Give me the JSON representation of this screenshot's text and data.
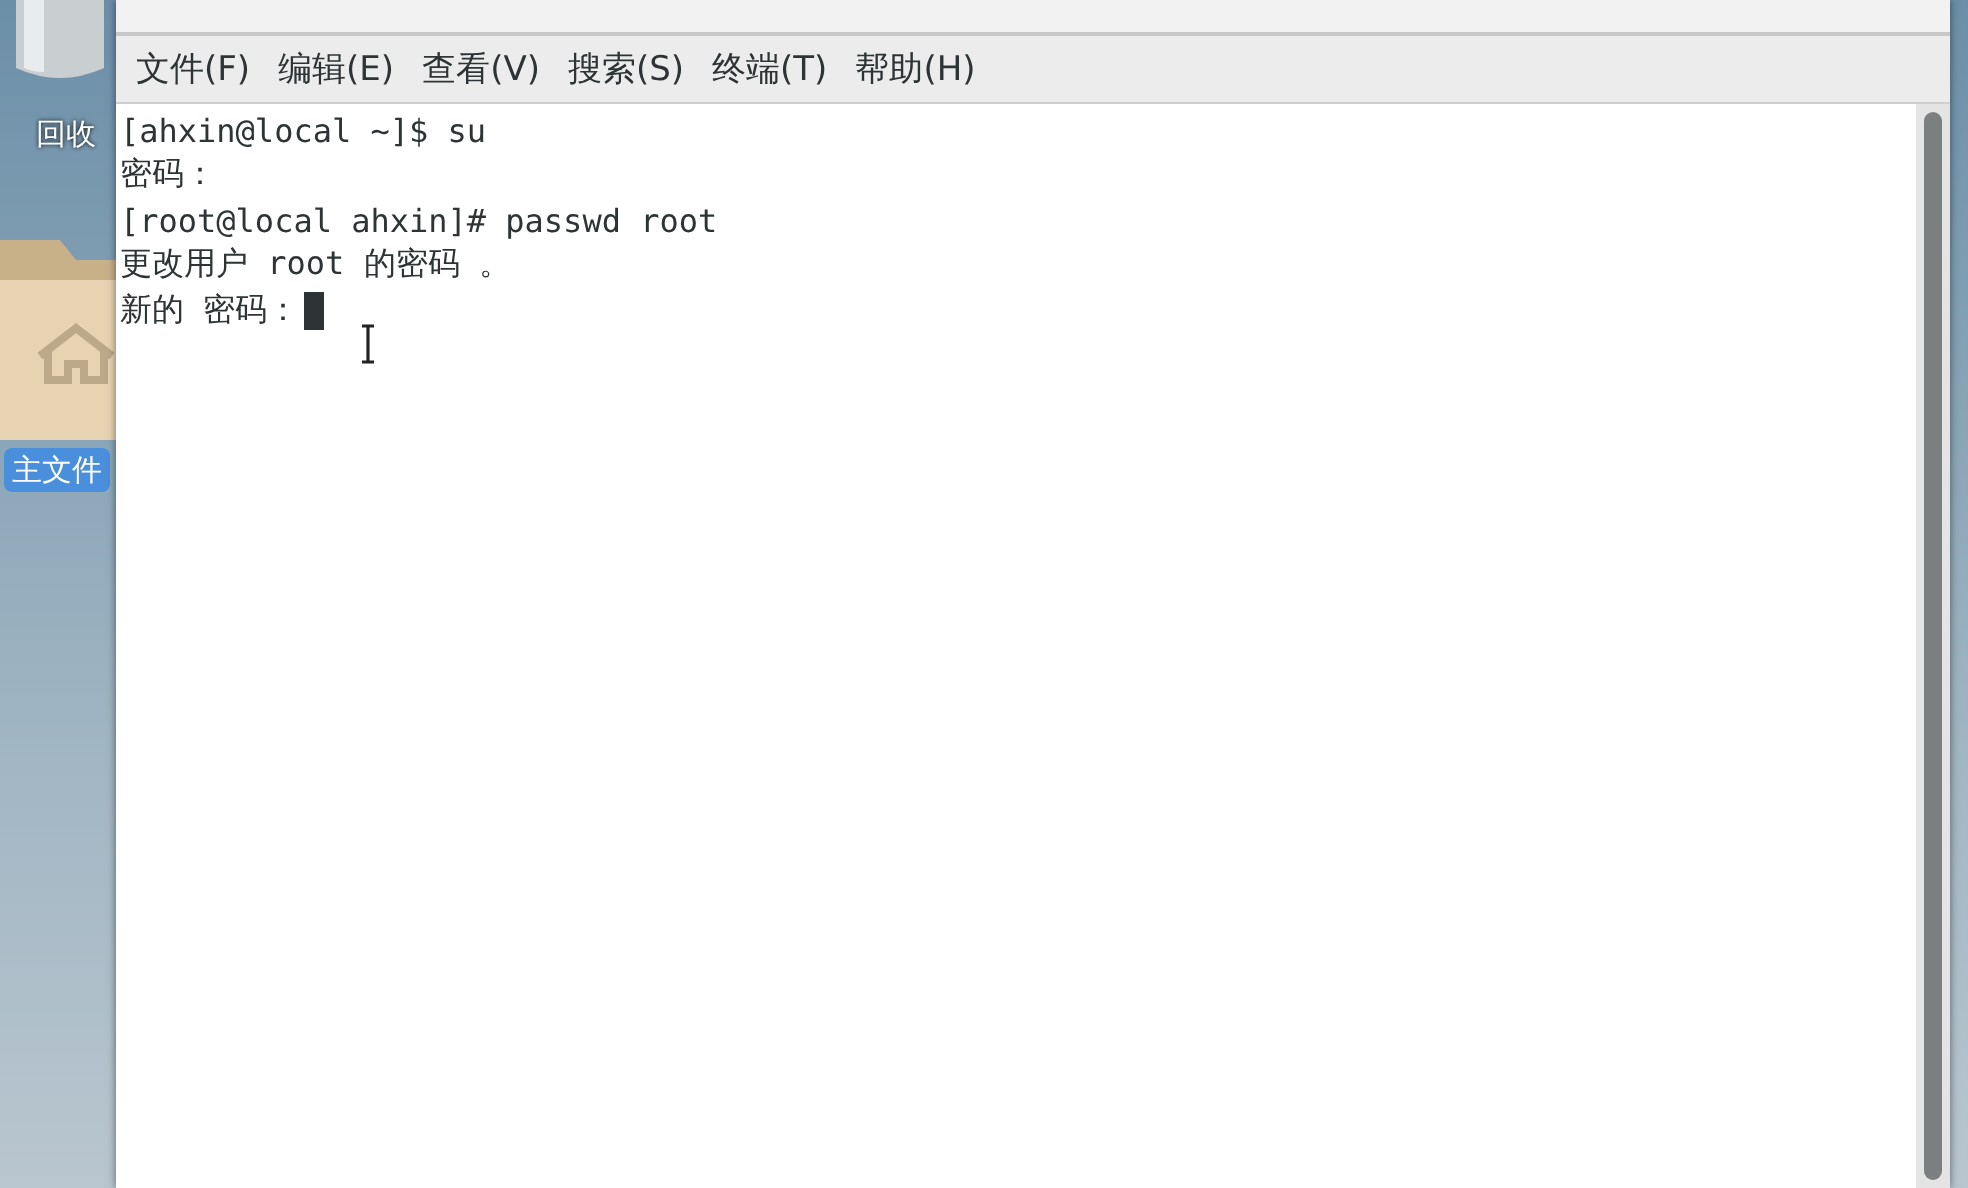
{
  "desktop": {
    "icons": [
      {
        "kind": "trash",
        "label": "回收",
        "selected": false
      },
      {
        "kind": "home-folder",
        "label": "主文件",
        "selected": true
      }
    ]
  },
  "menu_bar": {
    "items": [
      "文件(F)",
      "编辑(E)",
      "查看(V)",
      "搜索(S)",
      "终端(T)",
      "帮助(H)"
    ]
  },
  "terminal": {
    "lines": [
      "[ahxin@local ~]$ su",
      "密码：",
      "[root@local ahxin]# passwd root",
      "更改用户 root 的密码 。",
      "新的 密码："
    ]
  }
}
